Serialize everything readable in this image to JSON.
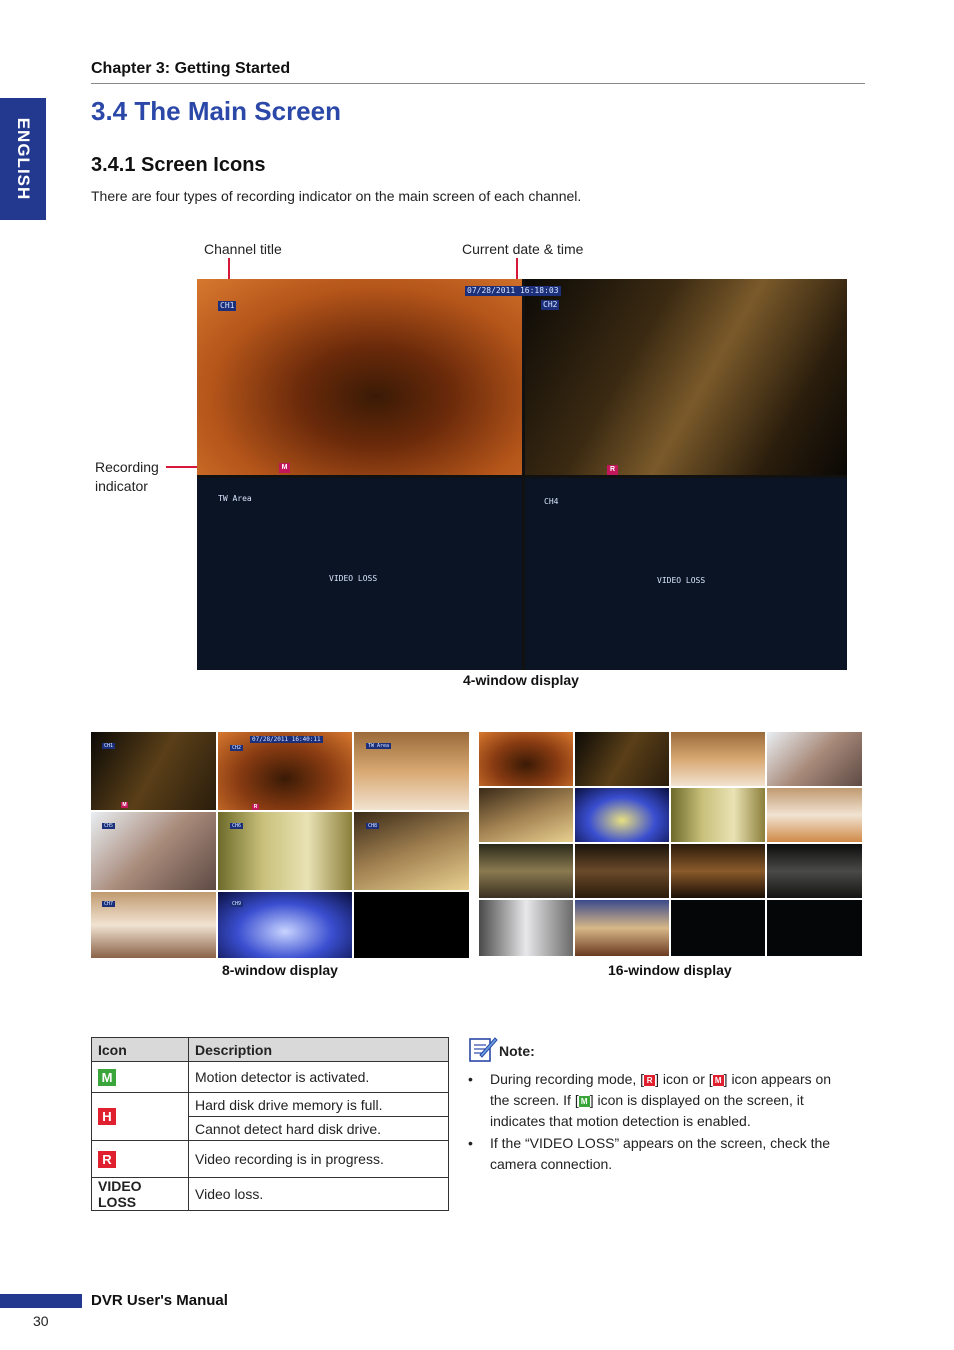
{
  "header": {
    "chapter": "Chapter 3: Getting Started",
    "side_tab": "ENGLISH"
  },
  "section": {
    "title": "3.4 The Main Screen",
    "subtitle": "3.4.1 Screen Icons",
    "intro": "There are four types of recording indicator on the main screen of each channel."
  },
  "figure4": {
    "label_channel": "Channel title",
    "label_datetime": "Current date & time",
    "label_recording_1": "Recording",
    "label_recording_2": "indicator",
    "caption": "4-window display",
    "ch1": "CH1",
    "ch2": "CH2",
    "ch3_title": "TW Area",
    "ch4": "CH4",
    "datetime_osd": "07/28/2011  16:18:03",
    "video_loss": "VIDEO LOSS",
    "rec_m": "M",
    "rec_r": "R"
  },
  "figure8": {
    "caption": "8-window display",
    "datetime_osd": "07/28/2011 16:40:11",
    "ch1": "CH1",
    "ch2": "CH2",
    "ch3_title": "TW Area",
    "ch5": "CH5",
    "ch6": "CH6",
    "ch7": "CH8",
    "ch8": "CH7",
    "ch9": "CH9",
    "rec_m": "M",
    "rec_r": "R"
  },
  "figure16": {
    "caption": "16-window display"
  },
  "icon_table": {
    "col_icon": "Icon",
    "col_desc": "Description",
    "rows": [
      {
        "icon": "M",
        "color": "#3aa53a",
        "desc": "Motion detector is activated."
      },
      {
        "icon": "H",
        "color": "#e0202e",
        "desc": "Hard disk drive memory is full.",
        "desc2": "Cannot detect hard disk drive."
      },
      {
        "icon": "R",
        "color": "#e0202e",
        "desc": "Video recording is in progress."
      },
      {
        "icon": "VIDEO LOSS",
        "desc": "Video loss."
      }
    ]
  },
  "note": {
    "title": "Note:",
    "b1_a": "During recording mode, [",
    "b1_b": "] icon or [",
    "b1_c": "] icon appears on the screen. If [",
    "b1_d": "] icon is displayed on the screen, it indicates that motion detection is enabled.",
    "b1_r": "R",
    "b1_m": "M",
    "b2": "If the “VIDEO LOSS” appears on the screen, check the camera connection."
  },
  "footer": {
    "manual": "DVR User's Manual",
    "page": "30"
  }
}
